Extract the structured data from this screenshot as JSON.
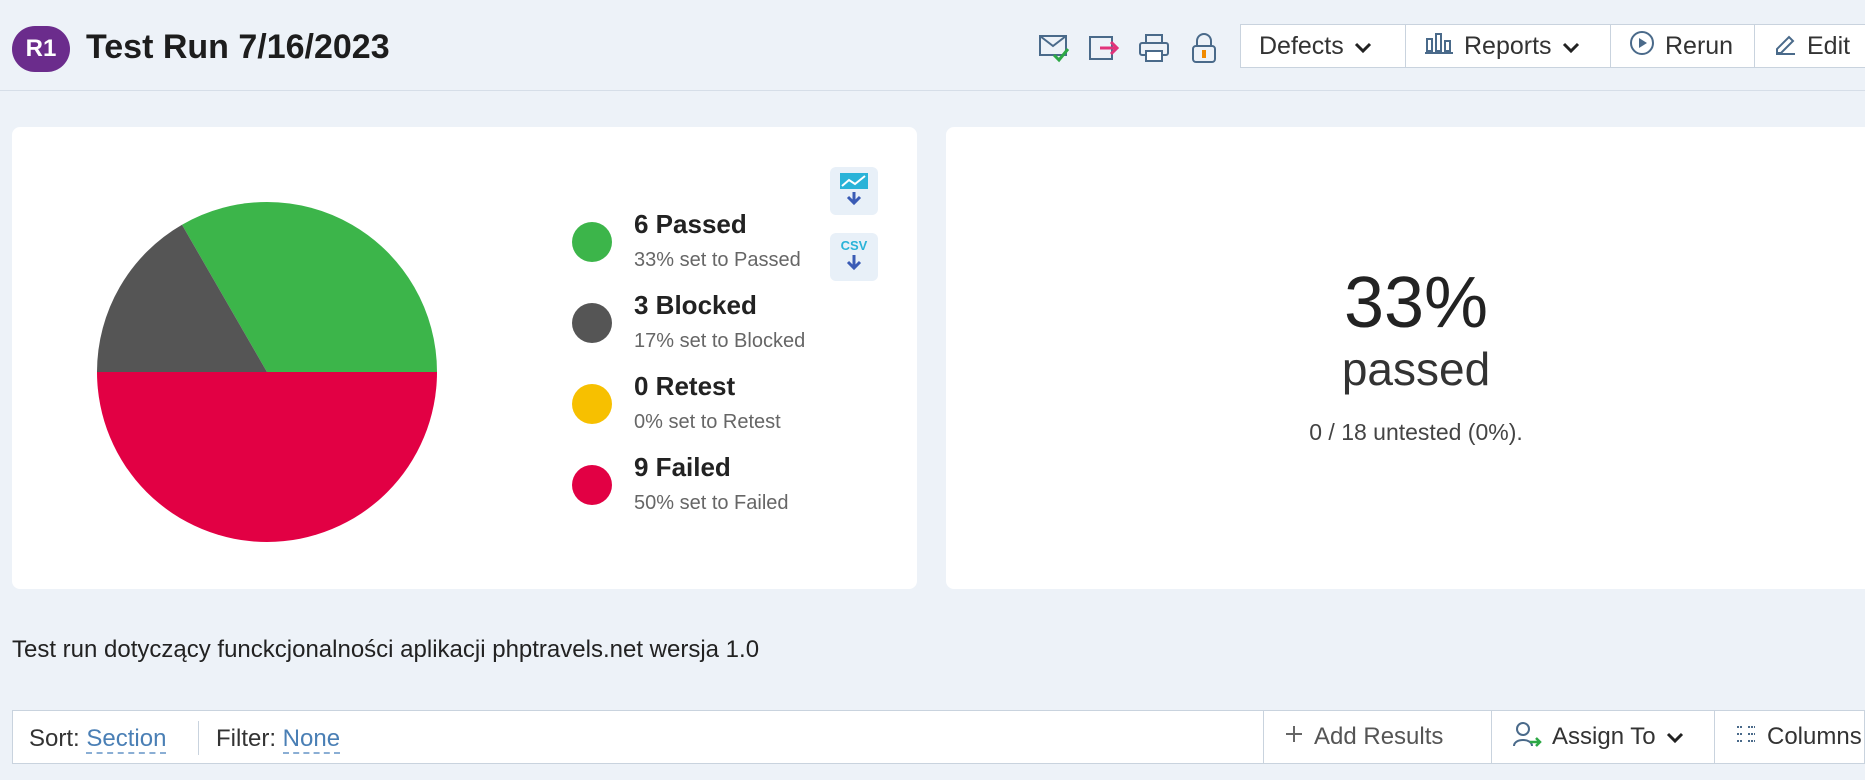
{
  "header": {
    "badge": "R1",
    "title": "Test Run 7/16/2023",
    "defects_label": "Defects",
    "reports_label": "Reports",
    "rerun_label": "Rerun",
    "edit_label": "Edit"
  },
  "chart_data": {
    "type": "pie",
    "categories": [
      "Passed",
      "Blocked",
      "Retest",
      "Failed"
    ],
    "values": [
      6,
      3,
      0,
      9
    ],
    "colors": [
      "#3cb54a",
      "#555555",
      "#f7c000",
      "#e20044"
    ]
  },
  "legend": [
    {
      "title": "6 Passed",
      "subtitle": "33% set to Passed",
      "color": "#3cb54a"
    },
    {
      "title": "3 Blocked",
      "subtitle": "17% set to Blocked",
      "color": "#555555"
    },
    {
      "title": "0 Retest",
      "subtitle": "0% set to Retest",
      "color": "#f7c000"
    },
    {
      "title": "9 Failed",
      "subtitle": "50% set to Failed",
      "color": "#e20044"
    }
  ],
  "downloads": {
    "csv_label": "CSV"
  },
  "summary": {
    "percent": "33%",
    "label": "passed",
    "untested": "0 / 18 untested (0%)."
  },
  "description": "Test run dotyczący funckcjonalności aplikacji phptravels.net wersja 1.0",
  "filter_bar": {
    "sort_label": "Sort:",
    "sort_value": "Section",
    "filter_label": "Filter:",
    "filter_value": "None",
    "add_results_label": "Add Results",
    "assign_to_label": "Assign To",
    "columns_label": "Columns"
  },
  "colors": {
    "accent": "#6b2c8c",
    "link": "#4a7fb5",
    "background": "#edf2f8"
  }
}
